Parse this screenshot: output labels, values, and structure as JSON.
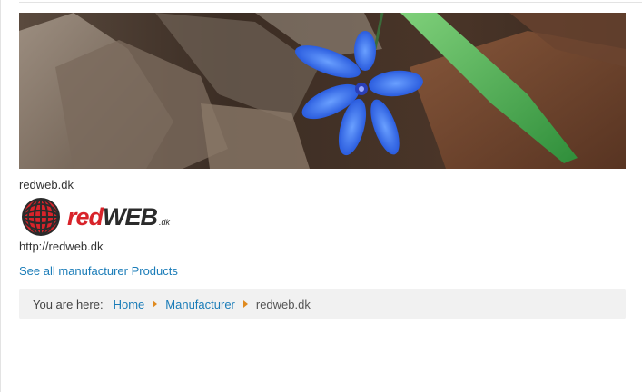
{
  "manufacturer": {
    "name": "redweb.dk",
    "logo_text": "redWEB",
    "logo_suffix": ".dk",
    "url": "http://redweb.dk",
    "all_products_link": "See all manufacturer Products"
  },
  "breadcrumb": {
    "label": "You are here:",
    "items": [
      {
        "label": "Home"
      },
      {
        "label": "Manufacturer"
      }
    ],
    "current": "redweb.dk"
  },
  "colors": {
    "link": "#1a7cb8",
    "logo_red": "#d8232a",
    "separator_orange": "#e08a1e",
    "breadcrumb_bg": "#f1f1f1"
  },
  "icons": {
    "breadcrumb_separator": "caret-right-icon",
    "logo_globe": "globe-icon"
  }
}
